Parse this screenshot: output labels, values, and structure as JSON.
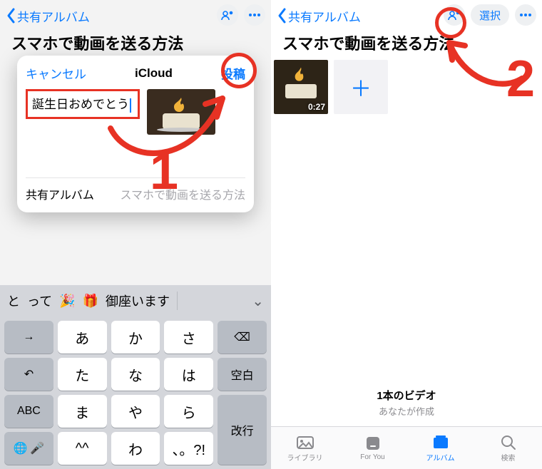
{
  "left": {
    "back_label": "共有アルバム",
    "album_title": "スマホで動画を送る方法",
    "modal": {
      "cancel": "キャンセル",
      "title": "iCloud",
      "post": "投稿",
      "caption_value": "誕生日おめでとう",
      "footer_left": "共有アルバム",
      "footer_right": "スマホで動画を送る方法"
    },
    "predictions": {
      "p0": "と",
      "p1": "って",
      "p2": "🎉",
      "p3": "🎁",
      "p4": "御座います"
    },
    "keys": {
      "r0": {
        "k0": "→",
        "k1": "あ",
        "k2": "か",
        "k3": "さ",
        "k4": "⌫"
      },
      "r1": {
        "k0": "↶",
        "k1": "た",
        "k2": "な",
        "k3": "は",
        "k4": "空白"
      },
      "r2": {
        "k0": "ABC",
        "k1": "ま",
        "k2": "や",
        "k3": "ら",
        "k4": "改行"
      },
      "r3": {
        "k0": "🌐",
        "k1": "🎤",
        "k2": "^^",
        "k3": "わ",
        "k4": "、。?!"
      }
    }
  },
  "right": {
    "back_label": "共有アルバム",
    "select_label": "選択",
    "album_title": "スマホで動画を送る方法",
    "video_duration": "0:27",
    "add_label": "＋",
    "meta_line1": "1本のビデオ",
    "meta_line2": "あなたが作成",
    "tabs": {
      "t0": "ライブラリ",
      "t1": "For You",
      "t2": "アルバム",
      "t3": "検索"
    }
  },
  "annotations": {
    "step1": "1",
    "step2": "2"
  }
}
